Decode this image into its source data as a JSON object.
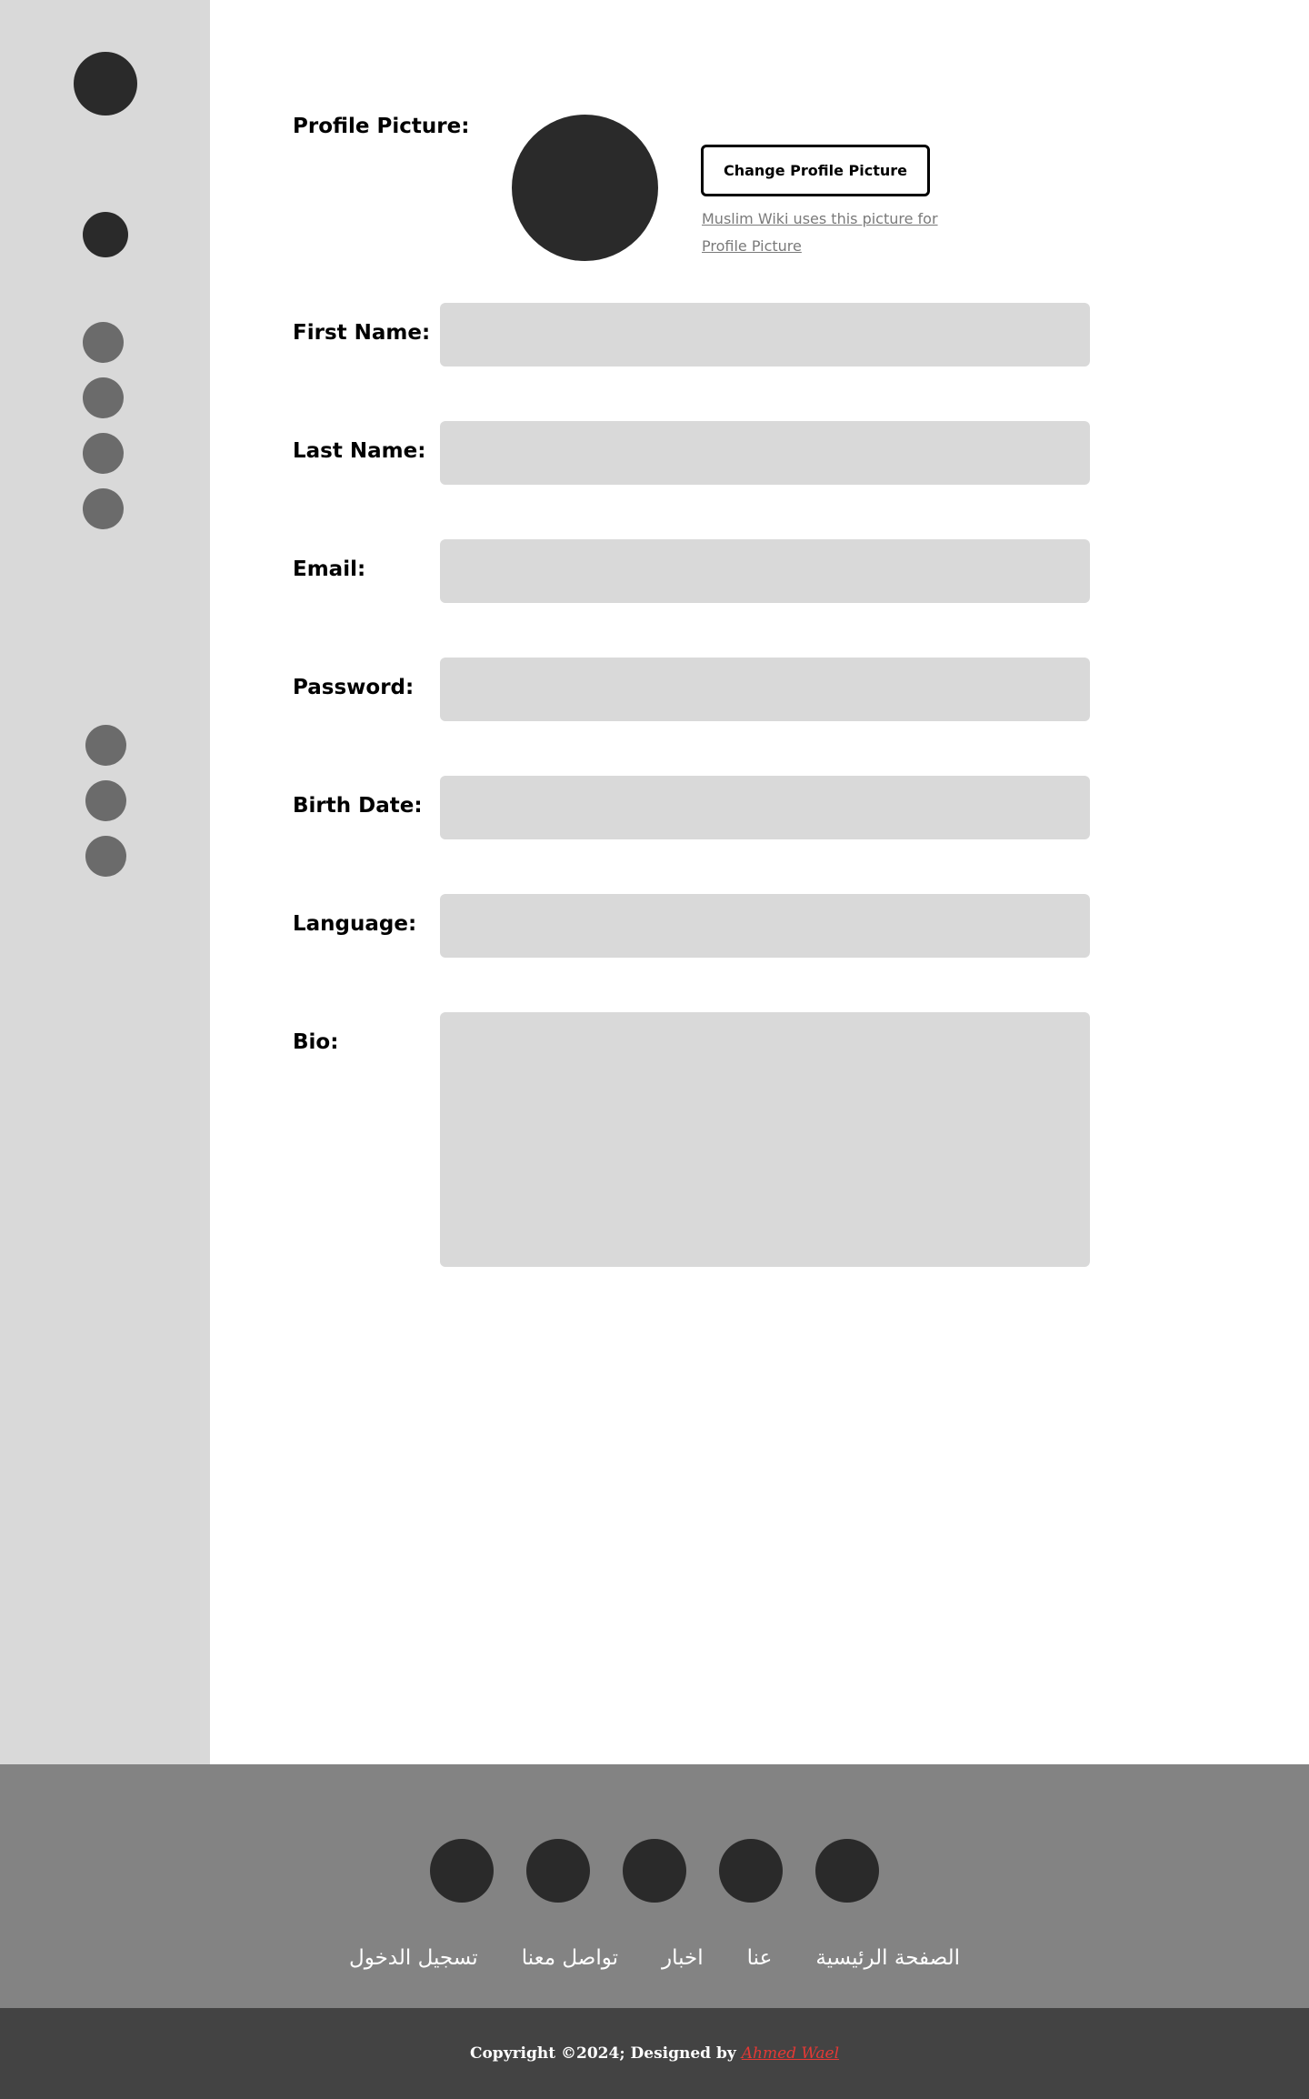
{
  "sidebar": {
    "logo_icon": "logo-icon",
    "home_icon": "home-icon",
    "group1_icons": [
      "nav-icon-1",
      "nav-icon-2",
      "nav-icon-3",
      "nav-icon-4"
    ],
    "group2_icons": [
      "nav-icon-5",
      "nav-icon-6",
      "nav-icon-7"
    ]
  },
  "profile": {
    "picture_label": "Profile Picture:",
    "change_button": "Change Profile Picture",
    "hint": "Muslim Wiki uses this picture for Profile Picture"
  },
  "form": {
    "first_name_label": "First Name:",
    "last_name_label": "Last Name:",
    "email_label": "Email:",
    "password_label": "Password:",
    "birth_date_label": "Birth Date:",
    "language_label": "Language:",
    "bio_label": "Bio:"
  },
  "footer": {
    "social_icons": [
      "social-icon-1",
      "social-icon-2",
      "social-icon-3",
      "social-icon-4",
      "social-icon-5"
    ],
    "nav": [
      "الصفحة الرئيسية",
      "عنا",
      "اخبار",
      "تواصل معنا",
      "تسجيل الدخول"
    ],
    "copyright": "Copyright  ©2024; Designed by",
    "author": "Ahmed Wael"
  },
  "colors": {
    "sidebar_bg": "#d9d9d9",
    "footer_bg": "#838383",
    "copyright_bg": "#434343",
    "author_accent": "#e53935",
    "dark_circle": "#2a2a2a"
  }
}
